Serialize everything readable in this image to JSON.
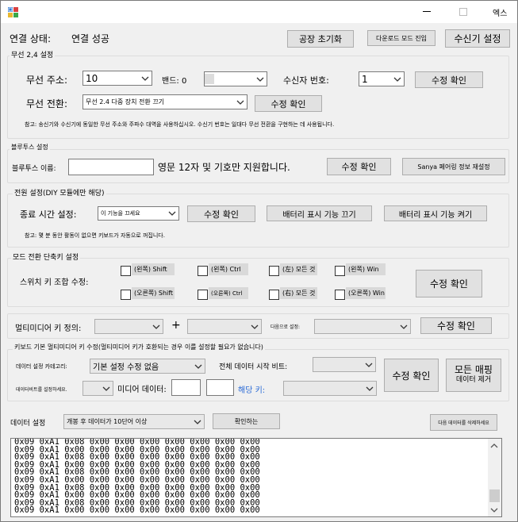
{
  "window": {
    "close_label": "엑스"
  },
  "header": {
    "connection_label": "연결 상태:",
    "connection_value": "연결 성공",
    "factory_reset": "공장 초기화",
    "download_mode": "다운로드 모드 진입",
    "receiver_settings": "수신기 설정"
  },
  "wireless": {
    "group_title": "무선 2,4 설정",
    "address_label": "무선 주소:",
    "address_value": "10",
    "band_label": "밴드: 0",
    "band_value": "",
    "receiver_no_label": "수신자 번호:",
    "receiver_no_value": "1",
    "confirm1": "수정 확인",
    "switch_label": "무선 전환:",
    "switch_value": "무선 2.4 다중 장치 전환 끄기",
    "confirm2": "수정 확인",
    "note": "참고: 송신기와 수신기에 동일한 무선 주소와 주파수 대역을 사용하십시오. 수신기 번호는 일대다 무선 전환을 구현하는 데 사용됩니다."
  },
  "bluetooth": {
    "group_title": "블루투스 설정",
    "name_label": "블루투스 이름:",
    "name_value": "",
    "hint": "영문 12자 및 기호만 지원합니다.",
    "confirm": "수정 확인",
    "reset_pairing": "Sanya 페어링 정보 재설정"
  },
  "power": {
    "group_title": "전원 설정(DIY 모듈에만 해당)",
    "shutdown_label": "종료 시간 설정:",
    "shutdown_value": "이 기능을 끄세요",
    "confirm": "수정 확인",
    "battery_off": "배터리 표시 기능 끄기",
    "battery_on": "배터리 표시 기능 켜기",
    "note": "참고: 몇 분 동안 활동이 없으면 키보드가 자동으로 꺼집니다."
  },
  "mode_switch": {
    "group_title": "모드 전환 단축키 설정",
    "combo_label": "스위치 키 조합 수정:",
    "keys": [
      "(왼쪽) Shift",
      "(왼쪽) Ctrl",
      "(左) 모든 것",
      "(왼쪽) Win",
      "(오른쪽) Shift",
      "(오른쪽) Ctrl",
      "(右) 모든 것",
      "(오른쪽) Win"
    ],
    "confirm": "수정 확인"
  },
  "multimedia_def": {
    "label": "멀티미디어 키 정의:",
    "combo1": "",
    "plus": "+",
    "combo2": "",
    "next_label": "다음으로 설정:",
    "combo3": "",
    "confirm": "수정 확인"
  },
  "kb_multimedia": {
    "group_title": "키보드 기본 멀티미디어 키 수정(멀티미디어 키가 호환되는 경우 이를 설정할 필요가 없습니다)",
    "category_label": "데이터 설정 카테고리:",
    "category_value": "기본 설정 수정 없음",
    "start_bit_label": "전체 데이터 시작 비트:",
    "start_bit_value": "",
    "confirm": "수정 확인",
    "map_all_line1": "모든 매핑",
    "map_all_line2": "데이터 제거",
    "select_data_label": "데이터비트를 설정하세요.",
    "select_data_value": "",
    "media_data_label": "미디어 데이터:",
    "media_data_1": "",
    "media_data_2": "",
    "key_label": "해당 키:",
    "key_value": ""
  },
  "data_settings": {
    "label": "데이터 설정",
    "combo_value": "개봉 후 데이터가 10단어 이상",
    "check_button": "확인하는",
    "delete_button": "다음 데이터를 삭제하세요"
  },
  "log": {
    "lines": [
      "0x09 0xA1 0x08 0x00 0x00 0x00 0x00 0x00 0x00 0x00",
      "0x09 0xA1 0x00 0x00 0x00 0x00 0x00 0x00 0x00 0x00",
      "0x09 0xA1 0x08 0x00 0x00 0x00 0x00 0x00 0x00 0x00",
      "0x09 0xA1 0x00 0x00 0x00 0x00 0x00 0x00 0x00 0x00",
      "0x09 0xA1 0x08 0x00 0x00 0x00 0x00 0x00 0x00 0x00",
      "0x09 0xA1 0x00 0x00 0x00 0x00 0x00 0x00 0x00 0x00",
      "0x09 0xA1 0x08 0x00 0x00 0x00 0x00 0x00 0x00 0x00",
      "0x09 0xA1 0x00 0x00 0x00 0x00 0x00 0x00 0x00 0x00",
      "0x09 0xA1 0x08 0x00 0x00 0x00 0x00 0x00 0x00 0x00",
      "0x09 0xA1 0x00 0x00 0x00 0x00 0x00 0x00 0x00 0x00"
    ]
  },
  "icons": {
    "app": "app-icon",
    "minimize": "minimize-icon",
    "maximize": "maximize-icon",
    "dropdown": "chevron-down-icon"
  }
}
